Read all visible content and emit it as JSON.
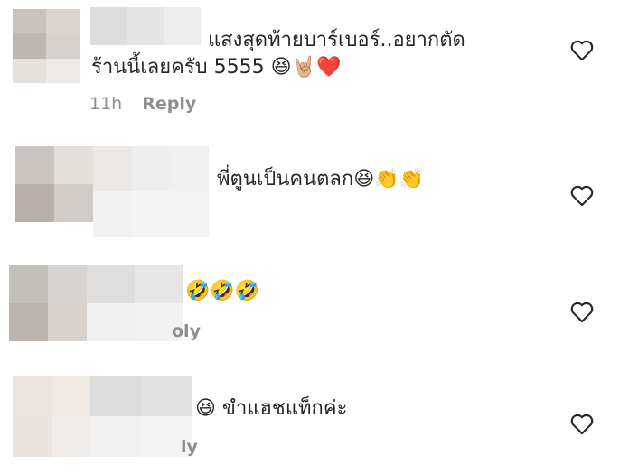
{
  "comments": [
    {
      "line1": "แสงสุดท้ายบาร์เบอร์..อยากตัด",
      "line2": "ร้านนี้เลยครับ 5555 😆🤘🏼❤️",
      "time": "11h",
      "reply": "Reply"
    },
    {
      "text": "พี่ตูนเป็นคนตลก😆👏👏"
    },
    {
      "text": "🤣🤣🤣",
      "reply_partial": "oly"
    },
    {
      "text": "😆 ขำแฮชแท็กค่ะ",
      "reply_partial": "ly"
    }
  ],
  "icons": {
    "like": "heart-outline-icon"
  },
  "colors": {
    "text": "#262626",
    "meta": "#8e8e8e",
    "heart": "#262626"
  }
}
